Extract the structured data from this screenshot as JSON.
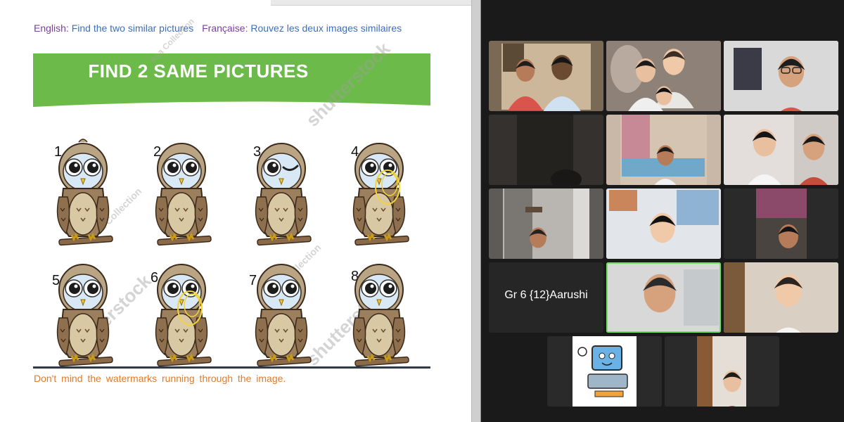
{
  "slide": {
    "instruction": {
      "en_label": "English:",
      "en_text": "Find the two similar pictures",
      "fr_label": "Française:",
      "fr_text": "Rouvez les deux images similaires"
    },
    "banner_title": "FIND 2 SAME PICTURES",
    "watermarks": [
      "shutterstock",
      "shutterstock",
      "shutterstock",
      "Asa Collection",
      "Asa Collection",
      "Asa Collection"
    ],
    "owls": [
      {
        "number": "1",
        "eyes": "open",
        "tuft": true,
        "annotated": false
      },
      {
        "number": "2",
        "eyes": "open",
        "tuft": false,
        "annotated": false
      },
      {
        "number": "3",
        "eyes": "wink",
        "tuft": false,
        "annotated": false
      },
      {
        "number": "4",
        "eyes": "open",
        "tuft": false,
        "annotated": true
      },
      {
        "number": "5",
        "eyes": "open",
        "tuft": false,
        "annotated": false
      },
      {
        "number": "6",
        "eyes": "open",
        "tuft": false,
        "annotated": true
      },
      {
        "number": "7",
        "eyes": "open",
        "tuft": false,
        "annotated": false
      },
      {
        "number": "8",
        "eyes": "open",
        "tuft": false,
        "annotated": false
      }
    ],
    "footer_note": "Don't mind the watermarks running through the image."
  },
  "gallery": {
    "tiles": [
      {
        "type": "video",
        "scene": "two people at home"
      },
      {
        "type": "video",
        "scene": "mother and daughters"
      },
      {
        "type": "video",
        "scene": "boy with glasses"
      },
      {
        "type": "video",
        "scene": "dark room"
      },
      {
        "type": "video",
        "scene": "man on couch"
      },
      {
        "type": "video",
        "scene": "two children"
      },
      {
        "type": "video",
        "scene": "person in room"
      },
      {
        "type": "video",
        "scene": "girl at desk"
      },
      {
        "type": "video",
        "scene": "man by wardrobe"
      },
      {
        "type": "name",
        "name": "Gr 6 {12}Aarushi"
      },
      {
        "type": "video",
        "scene": "man speaking",
        "active": true
      },
      {
        "type": "video",
        "scene": "woman in white"
      },
      {
        "type": "avatar",
        "scene": "computer cartoon"
      },
      {
        "type": "video",
        "scene": "woman in doorway"
      }
    ]
  },
  "colors": {
    "banner_green": "#6cbb4a",
    "instruction_label": "#7a3ea0",
    "instruction_text": "#3d6fb7",
    "footer_orange": "#e07b2a",
    "annotation_yellow": "#f2d33a",
    "active_speaker": "#6fe05e"
  }
}
